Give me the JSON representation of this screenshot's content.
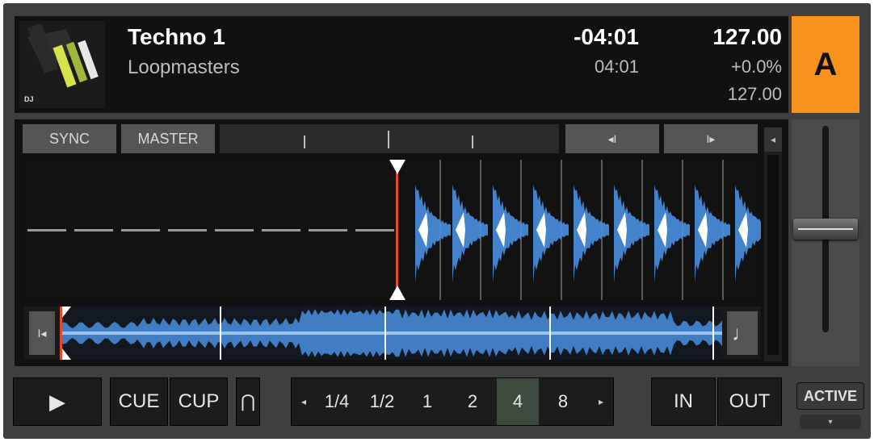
{
  "track": {
    "title": "Techno 1",
    "artist": "Loopmasters",
    "time_remaining": "-04:01",
    "time_elapsed": "04:01",
    "bpm": "127.00",
    "pitch": "+0.0%",
    "tempo": "127.00",
    "cover_badge": "DJ"
  },
  "deck": {
    "letter": "A",
    "accent_color": "#f7921c"
  },
  "buttons": {
    "sync": "SYNC",
    "master": "MASTER",
    "beatjump_back": "◂I",
    "beatjump_forward": "I▸",
    "cue": "CUE",
    "cup": "CUP",
    "flux": "⋂",
    "in": "IN",
    "out": "OUT",
    "active": "ACTIVE",
    "play": "▶",
    "scroll_left": "◂",
    "loop_prev": "◂",
    "loop_next": "▸",
    "active_dropdown": "▾",
    "overview_start": "I◂",
    "overview_note": "♩"
  },
  "loop_sizes": {
    "items": [
      "1/4",
      "1/2",
      "1",
      "2",
      "4",
      "8"
    ],
    "selected": "4"
  },
  "waveform": {
    "beat_marker": "1",
    "colors": {
      "wave": "#4a8fe0",
      "peak": "#ffffff",
      "playhead": "#e24a2c"
    }
  },
  "tempo_fader": {
    "position": 0.5
  }
}
